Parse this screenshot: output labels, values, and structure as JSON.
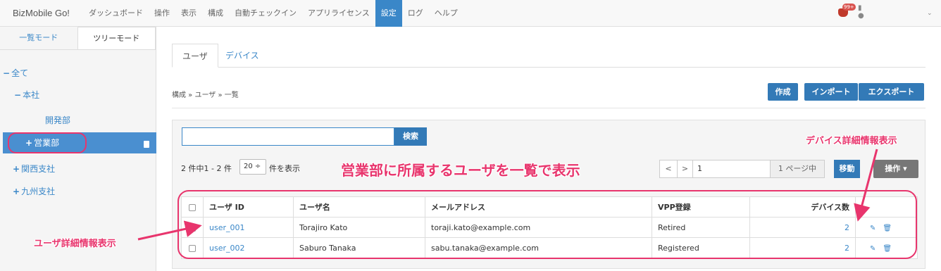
{
  "app": {
    "brand": "BizMobile Go!",
    "nav": [
      "ダッシュボード",
      "操作",
      "表示",
      "構成",
      "自動チェックイン",
      "アプリライセンス",
      "設定",
      "ログ",
      "ヘルプ"
    ],
    "active_nav": "設定",
    "notification_badge": "99+",
    "colors": {
      "accent": "#337ab7",
      "highlight": "#e8356d"
    }
  },
  "sidebar": {
    "tabs": [
      "一覧モード",
      "ツリーモード"
    ],
    "active_tab": "ツリーモード",
    "tree": [
      {
        "symbol": "−",
        "label": "全て"
      },
      {
        "symbol": "−",
        "label": "本社"
      },
      {
        "symbol": "",
        "label": "開発部"
      },
      {
        "symbol": "+",
        "label": "営業部",
        "selected": true
      },
      {
        "symbol": "+",
        "label": "関西支社"
      },
      {
        "symbol": "+",
        "label": "九州支社"
      }
    ]
  },
  "main": {
    "tabs": [
      "ユーザ",
      "デバイス"
    ],
    "active_tab": "ユーザ",
    "breadcrumb": "構成 » ユーザ » 一覧",
    "buttons": {
      "create": "作成",
      "import": "インポート",
      "export": "エクスポート"
    },
    "search": {
      "value": "",
      "button": "検索"
    },
    "count_text": "2 件中1 - 2 件",
    "per_page": "20 ÷",
    "per_page_label": "件を表示",
    "pager": {
      "prev": "<",
      "next": ">",
      "page": "1",
      "total": "1 ページ中",
      "move": "移動",
      "operation": "操作 ▾"
    },
    "table": {
      "headers": [
        "ユーザ ID",
        "ユーザ名",
        "メールアドレス",
        "VPP登録",
        "デバイス数"
      ],
      "rows": [
        {
          "id": "user_001",
          "name": "Torajiro Kato",
          "email": "toraji.kato@example.com",
          "vpp": "Retired",
          "devices": "2"
        },
        {
          "id": "user_002",
          "name": "Saburo Tanaka",
          "email": "sabu.tanaka@example.com",
          "vpp": "Registered",
          "devices": "2"
        }
      ]
    }
  },
  "annotations": {
    "center": "営業部に所属するユーザを一覧で表示",
    "device_detail": "デバイス詳細情報表示",
    "user_detail": "ユーザ詳細情報表示"
  }
}
